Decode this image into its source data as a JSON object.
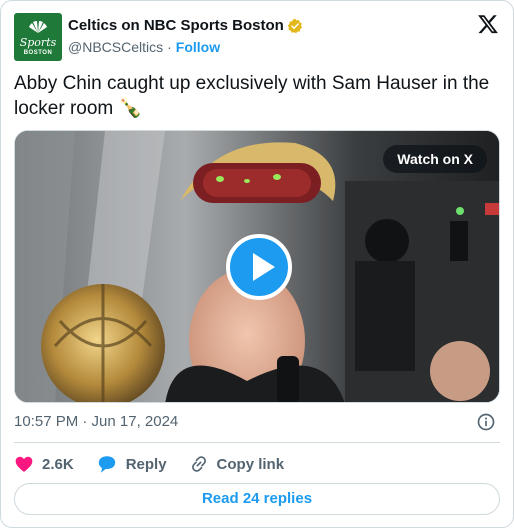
{
  "account": {
    "display_name": "Celtics on NBC Sports Boston",
    "handle": "@NBCSCeltics",
    "separator": "·",
    "follow_label": "Follow",
    "avatar_text_main": "Sports",
    "avatar_text_sub": "BOSTON",
    "verified_color": "#e2b719",
    "avatar_color": "#1f7a3a"
  },
  "tweet": {
    "text": "Abby Chin caught up exclusively with Sam Hauser in the locker room 🍾",
    "emoji_icon": "champagne-icon"
  },
  "media": {
    "watch_label": "Watch on X",
    "play_icon": "play-icon"
  },
  "meta": {
    "timestamp": "10:57 PM · Jun 17, 2024",
    "info_icon": "info-icon"
  },
  "actions": {
    "like_count": "2.6K",
    "reply_label": "Reply",
    "copy_label": "Copy link",
    "like_color": "#f91880",
    "reply_color": "#1d9bf0"
  },
  "footer": {
    "read_replies": "Read 24 replies"
  },
  "colors": {
    "accent": "#1d9bf0",
    "text_primary": "#0f1419",
    "text_secondary": "#536471",
    "border": "#cfd9de"
  }
}
